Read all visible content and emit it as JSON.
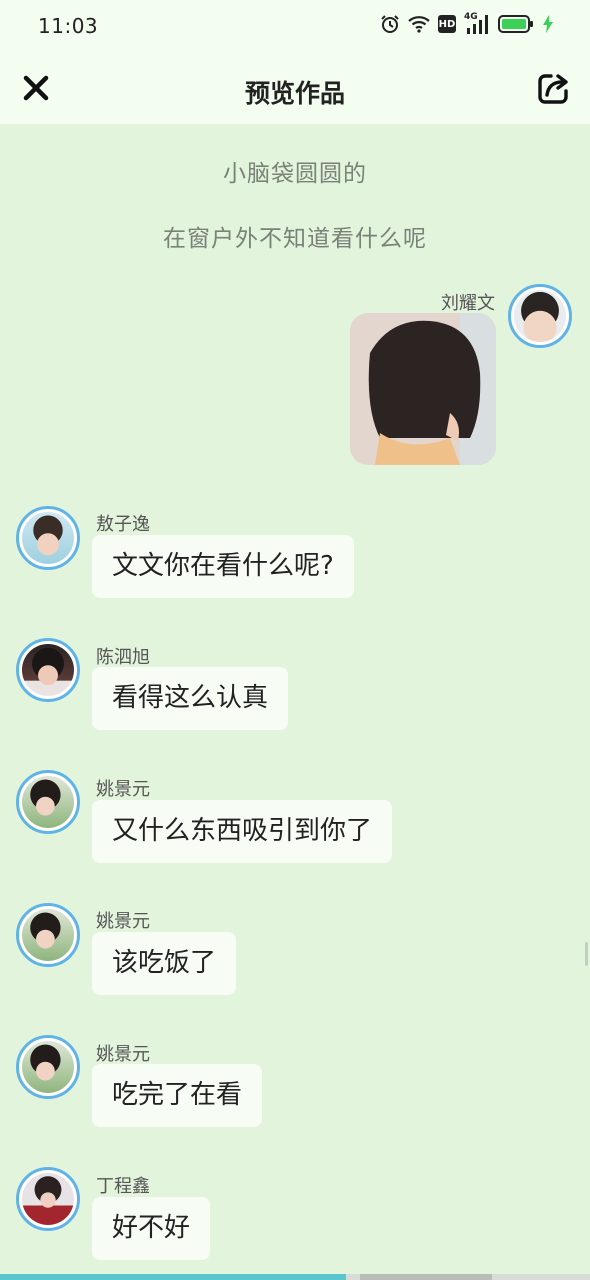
{
  "status_bar": {
    "time": "11:03",
    "hd_label": "HD",
    "network_label": "4G"
  },
  "header": {
    "title": "预览作品"
  },
  "narration": [
    "小脑袋圆圆的",
    "在窗户外不知道看什么呢"
  ],
  "self_message": {
    "sender": "刘耀文",
    "type": "image",
    "image_desc": "photo"
  },
  "messages": [
    {
      "sender": "敖子逸",
      "text": "文文你在看什么呢?"
    },
    {
      "sender": "陈泗旭",
      "text": "看得这么认真"
    },
    {
      "sender": "姚景元",
      "text": "又什么东西吸引到你了"
    },
    {
      "sender": "姚景元",
      "text": "该吃饭了"
    },
    {
      "sender": "姚景元",
      "text": "吃完了在看"
    },
    {
      "sender": "丁程鑫",
      "text": "好不好"
    }
  ],
  "colors": {
    "background": "#e3f4dd",
    "bar_background": "#f3fdf0",
    "avatar_ring": "#5fb3e6",
    "bubble": "#f7fcf5",
    "battery": "#3ccf5a"
  },
  "icons": [
    "alarm-icon",
    "wifi-icon",
    "signal-icon",
    "battery-icon",
    "charging-icon",
    "close-icon",
    "share-icon"
  ]
}
